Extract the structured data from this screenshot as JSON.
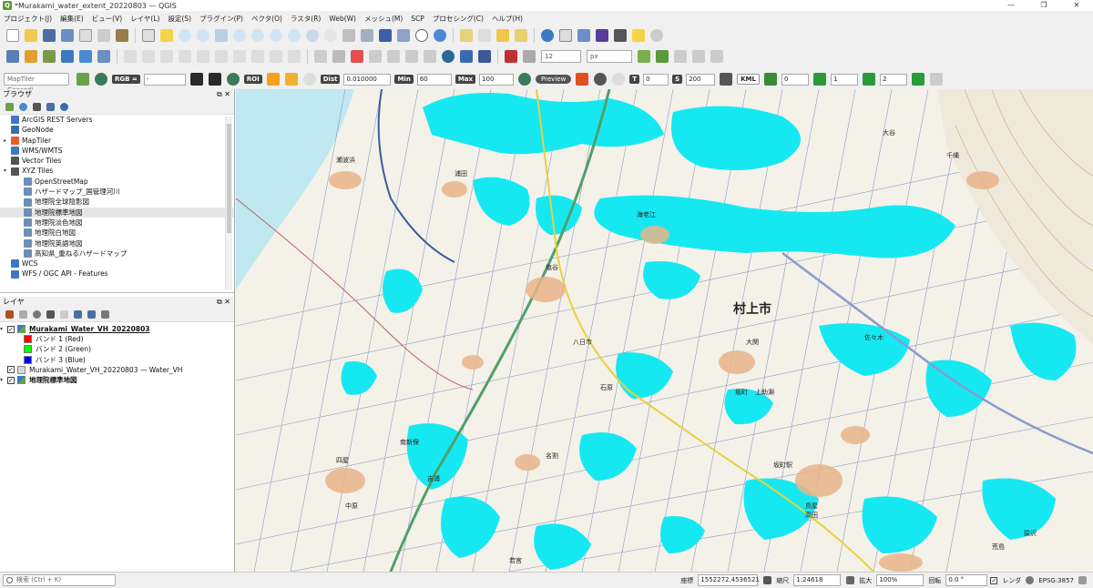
{
  "window": {
    "title": "*Murakami_water_extent_20220803 — QGIS",
    "controls": [
      "—",
      "❐",
      "✕"
    ]
  },
  "menu": [
    "プロジェクト(J)",
    "編集(E)",
    "ビュー(V)",
    "レイヤ(L)",
    "設定(S)",
    "プラグイン(P)",
    "ベクタ(O)",
    "ラスタ(R)",
    "Web(W)",
    "メッシュ(M)",
    "SCP",
    "プロセシング(C)",
    "ヘルプ(H)"
  ],
  "toolbar2": {
    "size_value": "12",
    "unit": "px"
  },
  "scp_toolbar": {
    "geocoder_placeholder": "MapTiler Geocodi···",
    "rgb_label": "RGB =",
    "rgb_value": "-",
    "roi_label": "ROI",
    "dist_label": "Dist",
    "dist_value": "0.010000",
    "min_label": "Min",
    "min_value": "60",
    "max_label": "Max",
    "max_value": "100",
    "preview_label": "Preview",
    "t_label": "T",
    "t_value": "0",
    "s_label": "S",
    "s_value": "200",
    "kml_label": "KML",
    "band_values": [
      "0",
      "1",
      "2"
    ]
  },
  "browser_panel": {
    "title": "ブラウザ",
    "items": [
      {
        "label": "ArcGIS REST Servers",
        "icon": "globe-icon",
        "color": "#3c78c3",
        "indent": 0,
        "arrow": ""
      },
      {
        "label": "GeoNode",
        "icon": "geonode-icon",
        "color": "#3a6fb0",
        "indent": 0,
        "arrow": ""
      },
      {
        "label": "MapTiler",
        "icon": "maptiler-icon",
        "color": "#e85d2a",
        "indent": 0,
        "arrow": "▸"
      },
      {
        "label": "WMS/WMTS",
        "icon": "globe-icon",
        "color": "#3c78c3",
        "indent": 0,
        "arrow": ""
      },
      {
        "label": "Vector Tiles",
        "icon": "vector-tiles-icon",
        "color": "#555555",
        "indent": 0,
        "arrow": ""
      },
      {
        "label": "XYZ Tiles",
        "icon": "xyz-tiles-icon",
        "color": "#555555",
        "indent": 0,
        "arrow": "▾"
      },
      {
        "label": "OpenStreetMap",
        "icon": "grid-icon",
        "color": "#6d8fb5",
        "indent": 1,
        "arrow": ""
      },
      {
        "label": "ハザードマップ_国管理河川",
        "icon": "grid-icon",
        "color": "#6d8fb5",
        "indent": 1,
        "arrow": ""
      },
      {
        "label": "地理院全球陰影図",
        "icon": "grid-icon",
        "color": "#6d8fb5",
        "indent": 1,
        "arrow": ""
      },
      {
        "label": "地理院標準地図",
        "icon": "grid-icon",
        "color": "#6d8fb5",
        "indent": 1,
        "arrow": "",
        "selected": true
      },
      {
        "label": "地理院淡色地図",
        "icon": "grid-icon",
        "color": "#6d8fb5",
        "indent": 1,
        "arrow": ""
      },
      {
        "label": "地理院白地図",
        "icon": "grid-icon",
        "color": "#6d8fb5",
        "indent": 1,
        "arrow": ""
      },
      {
        "label": "地理院英語地図",
        "icon": "grid-icon",
        "color": "#6d8fb5",
        "indent": 1,
        "arrow": ""
      },
      {
        "label": "高知県_重ねるハザードマップ",
        "icon": "grid-icon",
        "color": "#6d8fb5",
        "indent": 1,
        "arrow": ""
      },
      {
        "label": "WCS",
        "icon": "globe-icon",
        "color": "#3c78c3",
        "indent": 0,
        "arrow": ""
      },
      {
        "label": "WFS / OGC API - Features",
        "icon": "globe-icon",
        "color": "#3c78c3",
        "indent": 0,
        "arrow": ""
      }
    ]
  },
  "layers_panel": {
    "title": "レイヤ",
    "layers": [
      {
        "name": "Murakami_Water_VH_20220803",
        "bold": true,
        "checked": true,
        "expanded": true
      },
      {
        "name": "Murakami_Water_VH_20220803 — Water_VH",
        "bold": false,
        "checked": true,
        "expanded": false
      },
      {
        "name": "地理院標準地図",
        "bold": true,
        "checked": true,
        "expanded": false
      }
    ],
    "bands": [
      {
        "label": "バンド 1 (Red)",
        "color": "#ff0000"
      },
      {
        "label": "バンド 2 (Green)",
        "color": "#00ff00"
      },
      {
        "label": "バンド 3 (Blue)",
        "color": "#0000ff"
      }
    ]
  },
  "map": {
    "water_color": "#16e8f2",
    "place_labels": [
      "村上市",
      "大谷",
      "千縄",
      "瀬波浜",
      "浦田",
      "塩谷",
      "海老江",
      "大関",
      "南新保",
      "四屋",
      "中原",
      "八日市",
      "石原",
      "上助淵",
      "名割",
      "吉浦",
      "若宮",
      "高田",
      "鳥屋",
      "佐々木",
      "坂町駅",
      "坂町",
      "猿沢",
      "荒島"
    ]
  },
  "statusbar": {
    "search_placeholder": "検索 (Ctrl + K)",
    "coord_label": "座標",
    "coord_value": "1552272,4536521",
    "scale_label": "縮尺",
    "scale_value": "1:24618",
    "magnifier_label": "拡大",
    "magnifier_value": "100%",
    "rotation_label": "回転",
    "rotation_value": "0.0 °",
    "render_label": "レンダ",
    "crs_value": "EPSG:3857"
  }
}
